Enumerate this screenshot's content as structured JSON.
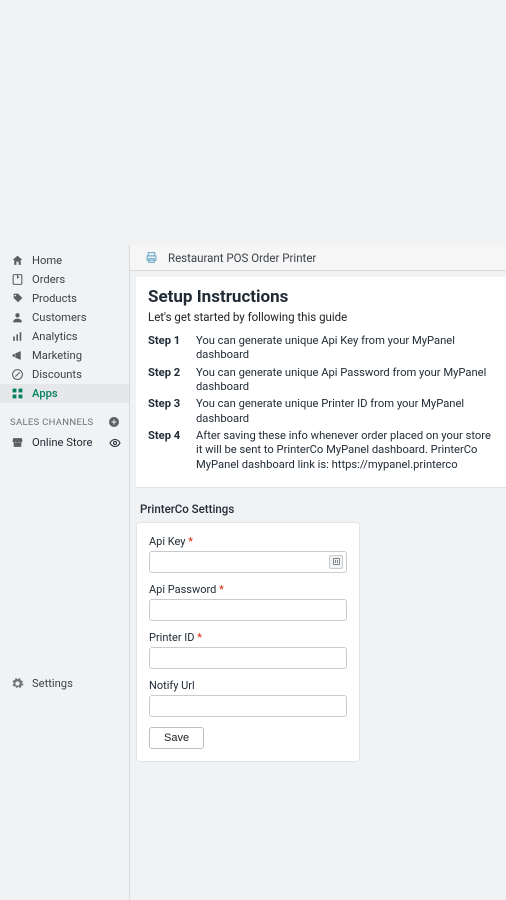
{
  "app_header": {
    "title": "Restaurant POS Order Printer"
  },
  "sidebar": {
    "items": [
      {
        "label": "Home"
      },
      {
        "label": "Orders"
      },
      {
        "label": "Products"
      },
      {
        "label": "Customers"
      },
      {
        "label": "Analytics"
      },
      {
        "label": "Marketing"
      },
      {
        "label": "Discounts"
      },
      {
        "label": "Apps"
      }
    ],
    "channels_header": "SALES CHANNELS",
    "channels": [
      {
        "label": "Online Store"
      }
    ],
    "footer": {
      "label": "Settings"
    }
  },
  "setup": {
    "title": "Setup Instructions",
    "subtitle": "Let's get started by following this guide",
    "steps": [
      {
        "label": "Step 1",
        "text": "You can generate unique Api Key from your MyPanel dashboard"
      },
      {
        "label": "Step 2",
        "text": "You can generate unique Api Password from your MyPanel dashboard"
      },
      {
        "label": "Step 3",
        "text": "You can generate unique Printer ID from your MyPanel dashboard"
      },
      {
        "label": "Step 4",
        "text": "After saving these info whenever order placed on your store it will be sent to PrinterCo MyPanel dashboard. PrinterCo MyPanel dashboard link is: https://mypanel.printerco"
      }
    ]
  },
  "settings": {
    "heading": "PrinterCo Settings",
    "fields": {
      "api_key": {
        "label": "Api Key",
        "required": true,
        "value": ""
      },
      "api_password": {
        "label": "Api Password",
        "required": true,
        "value": ""
      },
      "printer_id": {
        "label": "Printer ID",
        "required": true,
        "value": ""
      },
      "notify_url": {
        "label": "Notify Url",
        "required": false,
        "value": ""
      }
    },
    "save_label": "Save"
  }
}
